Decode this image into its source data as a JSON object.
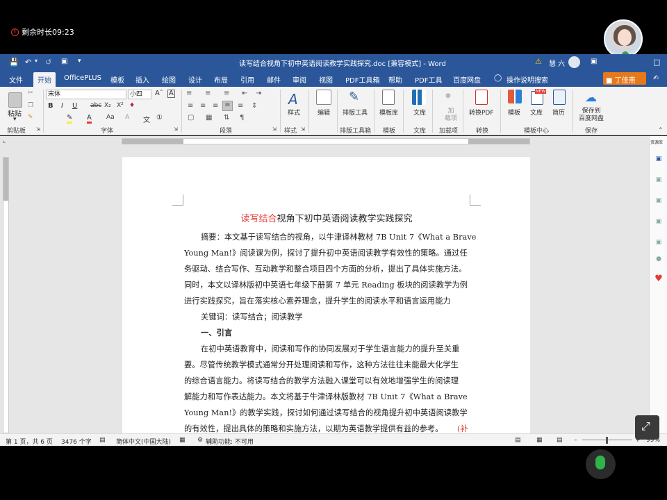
{
  "meeting": {
    "timer_text": "剩余时长09:23",
    "user_name": "丁佳燕",
    "account": "慧 六"
  },
  "titlebar": {
    "doc_title": "读写结合视角下初中英语阅读教学实践探究.doc [兼容模式] - Word"
  },
  "tabs": [
    "文件",
    "开始",
    "OfficePLUS",
    "模板",
    "插入",
    "绘图",
    "设计",
    "布局",
    "引用",
    "邮件",
    "审阅",
    "视图",
    "PDF工具箱",
    "帮助",
    "PDF工具",
    "百度网盘"
  ],
  "active_tab": "开始",
  "search_label": "操作说明搜索",
  "ribbon": {
    "clipboard": {
      "paste": "粘贴",
      "group": "剪贴板"
    },
    "font": {
      "family": "宋体",
      "size": "小四",
      "group": "字体",
      "bold": "B",
      "italic": "I",
      "underline": "U",
      "strike": "abc",
      "sub": "X₂",
      "sup": "X²",
      "font_color": "A",
      "aa": "Aa"
    },
    "paragraph": {
      "group": "段落"
    },
    "styles": {
      "label": "样式",
      "group": "样式"
    },
    "edit": {
      "label": "编辑"
    },
    "layout_tool": {
      "label": "排版工具",
      "group": "排版工具箱"
    },
    "template_lib": {
      "label": "模板库",
      "group": "模板"
    },
    "library": {
      "label": "文库",
      "group": "文库"
    },
    "addin": {
      "label": "加\n载项",
      "group": "加载项"
    },
    "convert": {
      "label": "转换PDF",
      "group": "转换"
    },
    "template": {
      "label": "模板"
    },
    "library2": {
      "label": "文库",
      "badge": "NEW"
    },
    "resume": {
      "label": "简历",
      "group": "模板中心"
    },
    "save_baidu": {
      "label": "保存到\n百度网盘",
      "group": "保存"
    }
  },
  "document": {
    "title_red": "读写结合",
    "title_rest": "视角下初中英语阅读教学实践探究",
    "lines": [
      "摘要：本文基于读写结合的视角，以牛津译林教材 7B Unit 7《What a Brave",
      "Young Man!》阅读课为例，探讨了提升初中英语阅读教学有效性的策略。通过任",
      "务驱动、结合写作、互动教学和整合项目四个方面的分析，提出了具体实施方法。",
      "同时，本文以译林版初中英语七年级下册第 7 单元 Reading 板块的阅读教学为例",
      "进行实践探究，旨在落实核心素养理念，提升学生的阅读水平和语言运用能力",
      "关键词：读写结合；阅读教学",
      "一、引言",
      "在初中英语教育中，阅读和写作的协同发展对于学生语言能力的提升至关重",
      "要。尽管传统教学模式通常分开处理阅读和写作，这种方法往往未能最大化学生",
      "的综合语言能力。将读写结合的教学方法融入课堂可以有效地增强学生的阅读理",
      "解能力和写作表达能力。本文将基于牛津译林版教材 7B Unit 7《What a Brave",
      "Young Man!》的教学实践，探讨如何通过读写结合的视角提升初中英语阅读教学",
      "的有效性，提出具体的策略和实施方法，以期为英语教学提供有益的参考。"
    ],
    "trailing_red": "(补"
  },
  "sidepanel": {
    "header": "资源库"
  },
  "statusbar": {
    "page": "第 1 页，共 6 页",
    "words": "3476 个字",
    "language": "简体中文(中国大陆)",
    "accessibility": "辅助功能: 不可用",
    "zoom": "99%"
  }
}
